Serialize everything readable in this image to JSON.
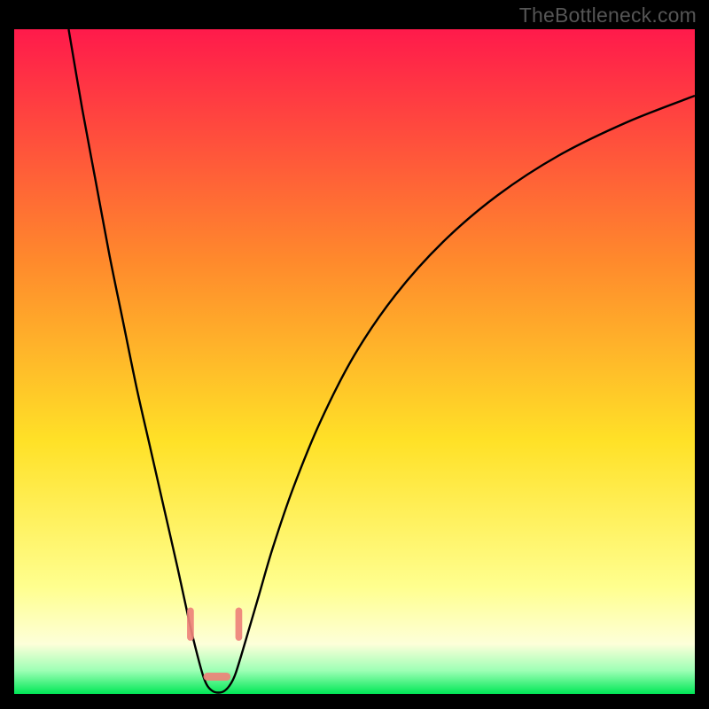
{
  "watermark": {
    "text": "TheBottleneck.com"
  },
  "chart_data": {
    "type": "line",
    "title": "",
    "xlabel": "",
    "ylabel": "",
    "xlim": [
      0,
      100
    ],
    "ylim": [
      0,
      100
    ],
    "grid": false,
    "legend": false,
    "background_gradient": {
      "stops": [
        {
          "pos": 0.0,
          "color": "#ff1a4b"
        },
        {
          "pos": 0.35,
          "color": "#ff8a2c"
        },
        {
          "pos": 0.62,
          "color": "#ffe127"
        },
        {
          "pos": 0.84,
          "color": "#ffff8f"
        },
        {
          "pos": 0.925,
          "color": "#fdffd9"
        },
        {
          "pos": 0.965,
          "color": "#9dffb5"
        },
        {
          "pos": 1.0,
          "color": "#00e756"
        }
      ]
    },
    "series": [
      {
        "name": "bottleneck-curve",
        "color": "#000000",
        "x": [
          8,
          10,
          12,
          14,
          16,
          18,
          20,
          22,
          24,
          25.8,
          27,
          27.8,
          28.4,
          29.2,
          30.0,
          30.8,
          31.6,
          32.5,
          34,
          36,
          38,
          41,
          45,
          50,
          56,
          63,
          71,
          80,
          90,
          100
        ],
        "y": [
          100,
          88,
          77,
          66,
          56,
          46,
          37,
          28,
          19,
          10.5,
          5.5,
          2.6,
          1.2,
          0.4,
          0.2,
          0.4,
          1.2,
          3.0,
          8.0,
          15,
          22,
          31,
          41,
          51,
          60,
          68,
          75,
          81,
          86,
          90
        ]
      }
    ],
    "annotations": [
      {
        "name": "marker-left",
        "shape": "capsule",
        "color": "#ee8279",
        "x_range": [
          25.4,
          26.4
        ],
        "y_range": [
          8.0,
          13.0
        ]
      },
      {
        "name": "marker-right",
        "shape": "capsule",
        "color": "#ee8279",
        "x_range": [
          32.5,
          33.5
        ],
        "y_range": [
          8.0,
          13.0
        ]
      },
      {
        "name": "marker-bottom",
        "shape": "capsule-horizontal",
        "color": "#ee8279",
        "x_range": [
          27.8,
          31.8
        ],
        "y_range": [
          2.0,
          3.2
        ]
      }
    ]
  }
}
